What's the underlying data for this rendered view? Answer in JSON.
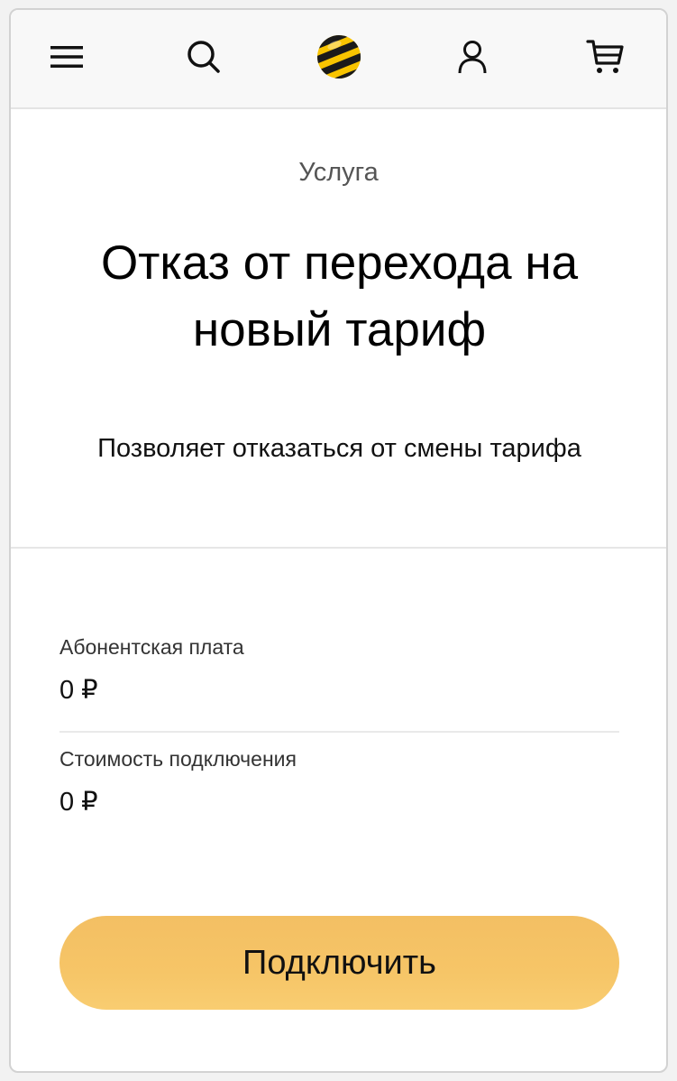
{
  "header": {
    "menu_icon": "hamburger-menu-icon",
    "search_icon": "search-icon",
    "logo_icon": "beeline-logo",
    "profile_icon": "user-icon",
    "cart_icon": "cart-icon"
  },
  "service": {
    "eyebrow": "Услуга",
    "title": "Отказ от перехода на новый тариф",
    "description": "Позволяет отказаться от смены тарифа"
  },
  "pricing": {
    "subscription_label": "Абонентская плата",
    "subscription_value": "0 ₽",
    "connection_label": "Стоимость подключения",
    "connection_value": "0 ₽"
  },
  "actions": {
    "connect_label": "Подключить"
  },
  "colors": {
    "accent": "#f6c567",
    "logo_yellow": "#f8c400",
    "logo_black": "#1a1a1a"
  }
}
